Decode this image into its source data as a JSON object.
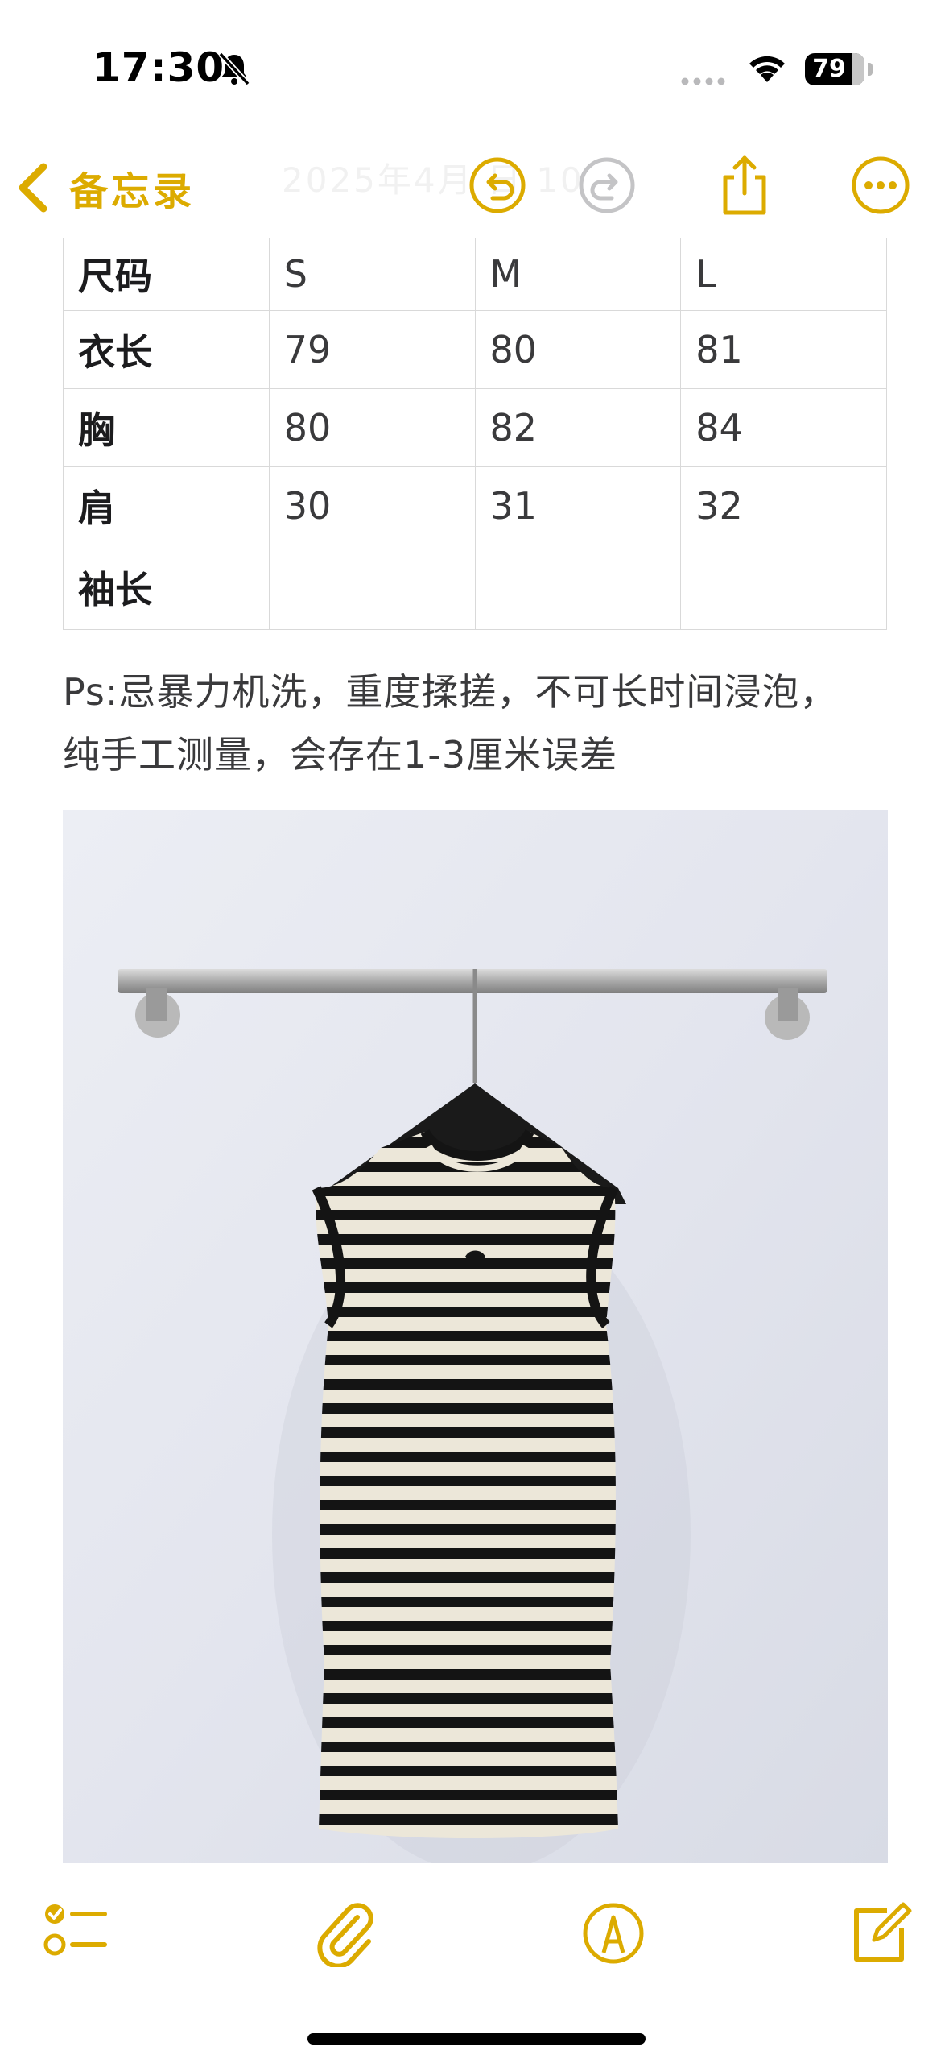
{
  "status_bar": {
    "time": "17:30",
    "battery_level": "79",
    "icons": [
      "bell-slash-icon",
      "signal-dots-icon",
      "wifi-icon",
      "battery-icon"
    ]
  },
  "nav": {
    "back_label": "备忘录",
    "faded_title": "2025年4月 日 10",
    "icons": [
      "chevron-left-icon",
      "undo-icon",
      "redo-icon",
      "share-icon",
      "more-icon"
    ],
    "accent_color": "#dcab00"
  },
  "table": {
    "header": [
      "尺码",
      "S",
      "M",
      "L"
    ],
    "rows": [
      [
        "衣长",
        "79",
        "80",
        "81"
      ],
      [
        "胸",
        "80",
        "82",
        "84"
      ],
      [
        "肩",
        "30",
        "31",
        "32"
      ],
      [
        "袖长",
        "",
        "",
        ""
      ]
    ]
  },
  "note": {
    "line1": "Ps:忌暴力机洗，重度揉搓，不可长时间浸泡，",
    "line2": "纯手工测量，会存在1-3厘米误差"
  },
  "photo": {
    "subject": "striped-sleeveless-knit-dress-photo"
  },
  "toolbar": {
    "icons": [
      "checklist-icon",
      "paperclip-icon",
      "markup-pen-icon",
      "compose-icon"
    ]
  }
}
